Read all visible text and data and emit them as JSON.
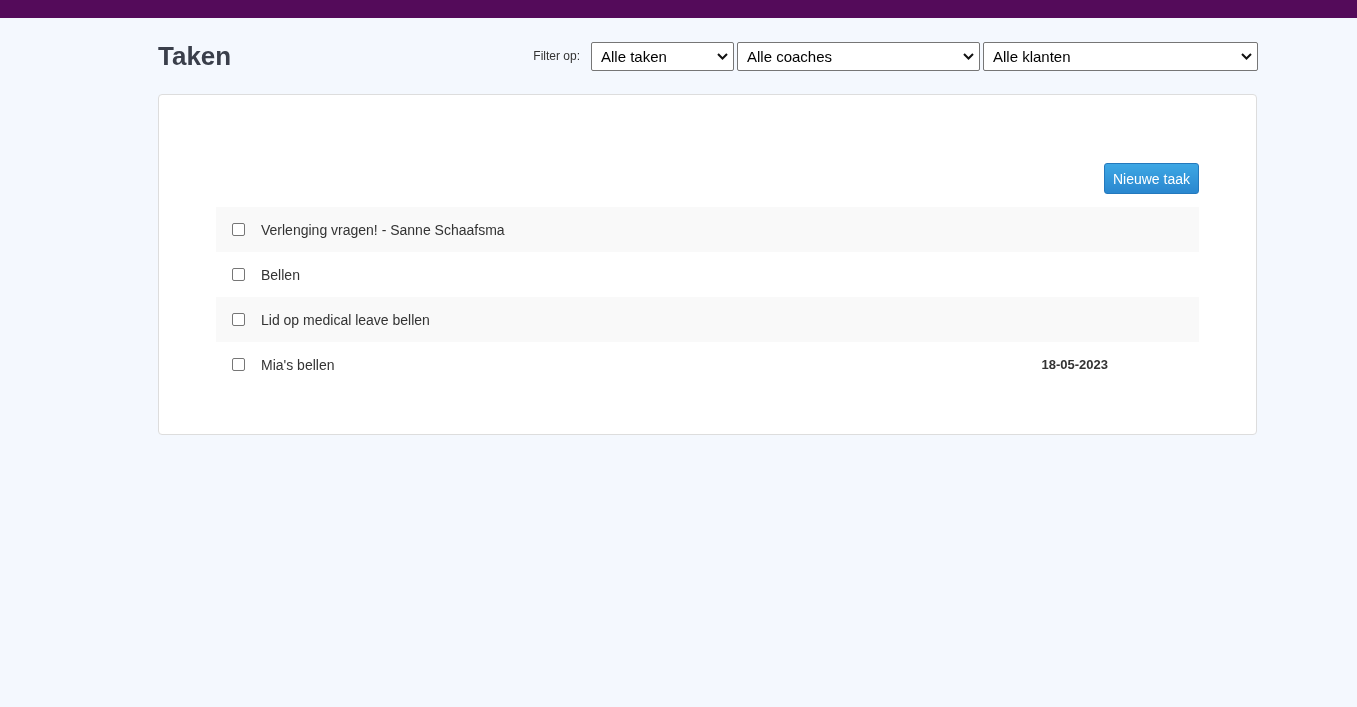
{
  "title": "Taken",
  "filter": {
    "label": "Filter op:",
    "selects": [
      {
        "value": "Alle taken"
      },
      {
        "value": "Alle coaches"
      },
      {
        "value": "Alle klanten"
      }
    ]
  },
  "new_button": "Nieuwe taak",
  "tasks": [
    {
      "title": "Verlenging vragen! - Sanne Schaafsma",
      "checked": false
    },
    {
      "title": "Bellen",
      "checked": false
    },
    {
      "title": "Lid op medical leave bellen",
      "checked": false
    },
    {
      "title": "Mia's bellen",
      "checked": false,
      "due": "18-05-2023"
    }
  ]
}
